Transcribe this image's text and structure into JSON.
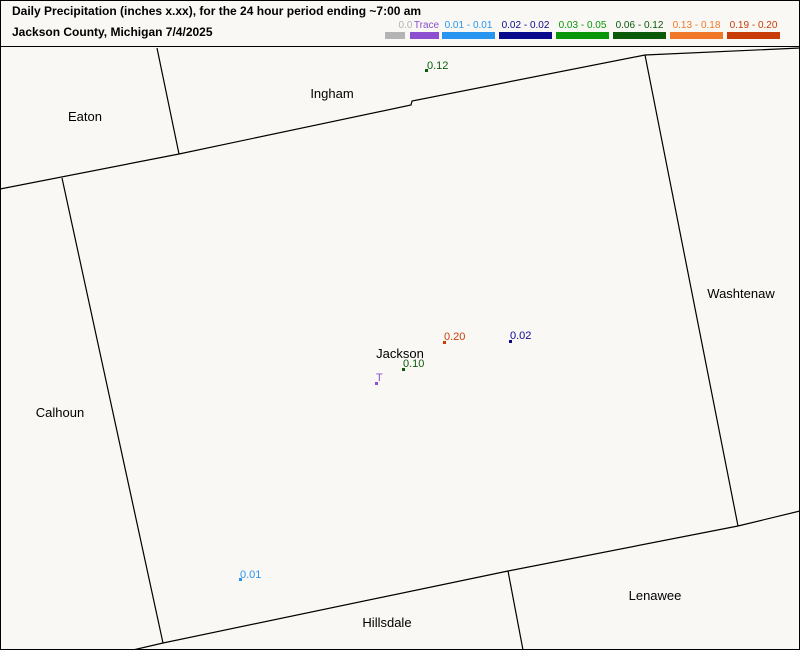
{
  "header": {
    "title_line1": "Daily Precipitation (inches  x.xx),  for the 24 hour period ending ~7:00 am",
    "title_line2": "Jackson County, Michigan  7/4/2025"
  },
  "legend": [
    {
      "label": "0.0",
      "color": "#b4b4b4"
    },
    {
      "label": "Trace",
      "color": "#8c4fd0"
    },
    {
      "label": "0.01 - 0.01",
      "color": "#2896f0"
    },
    {
      "label": "0.02 - 0.02",
      "color": "#0a0a8c"
    },
    {
      "label": "0.03 - 0.05",
      "color": "#0a960a"
    },
    {
      "label": "0.06 - 0.12",
      "color": "#0a5a0a"
    },
    {
      "label": "0.13 - 0.18",
      "color": "#f07828"
    },
    {
      "label": "0.19 - 0.20",
      "color": "#c83c0a"
    }
  ],
  "counties": {
    "eaton": "Eaton",
    "ingham": "Ingham",
    "washtenaw": "Washtenaw",
    "jackson": "Jackson",
    "calhoun": "Calhoun",
    "hillsdale": "Hillsdale",
    "lenawee": "Lenawee"
  },
  "observations": [
    {
      "value": "0.12",
      "color": "#0a5a0a"
    },
    {
      "value": "0.20",
      "color": "#c83c0a"
    },
    {
      "value": "0.02",
      "color": "#0a0a8c"
    },
    {
      "value": "0.10",
      "color": "#0a5a0a"
    },
    {
      "value": "T",
      "color": "#8c4fd0"
    },
    {
      "value": "0.01",
      "color": "#2896f0"
    }
  ]
}
